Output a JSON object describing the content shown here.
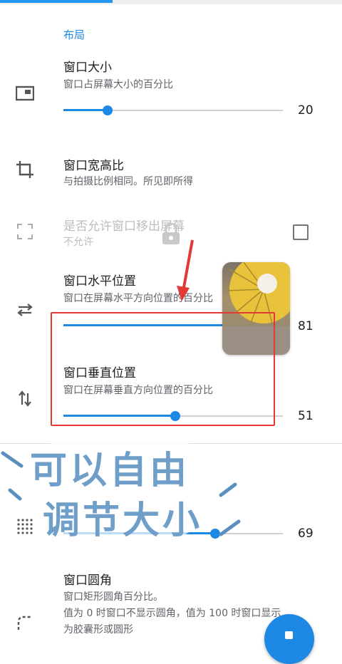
{
  "section": {
    "title": "布局"
  },
  "settings": {
    "window_size": {
      "title": "窗口大小",
      "sub": "窗口占屏幕大小的百分比",
      "value": "20",
      "level": 0.2
    },
    "aspect": {
      "title": "窗口宽高比",
      "sub": "与拍摄比例相同。所见即所得"
    },
    "allow_out": {
      "title": "是否允许窗口移出屏幕",
      "sub": "不允许",
      "checked": false
    },
    "hpos": {
      "title": "窗口水平位置",
      "sub": "窗口在屏幕水平方向位置的百分比",
      "value": "81",
      "level": 0.81
    },
    "vpos": {
      "title": "窗口垂直位置",
      "sub": "窗口在屏幕垂直方向位置的百分比",
      "value": "51",
      "level": 0.51
    },
    "hidden_slider": {
      "value": "69",
      "level": 0.69
    },
    "corner": {
      "title": "窗口圆角",
      "sub1": "窗口矩形圆角百分比。",
      "sub2": "值为 0 时窗口不显示圆角，值为 100 时窗口显示",
      "sub3": "为胶囊形或圆形"
    }
  },
  "overlay": {
    "line1": "可以自由",
    "line2": "调节大小"
  },
  "colors": {
    "accent": "#1e88e5",
    "highlight": "#e53935"
  }
}
